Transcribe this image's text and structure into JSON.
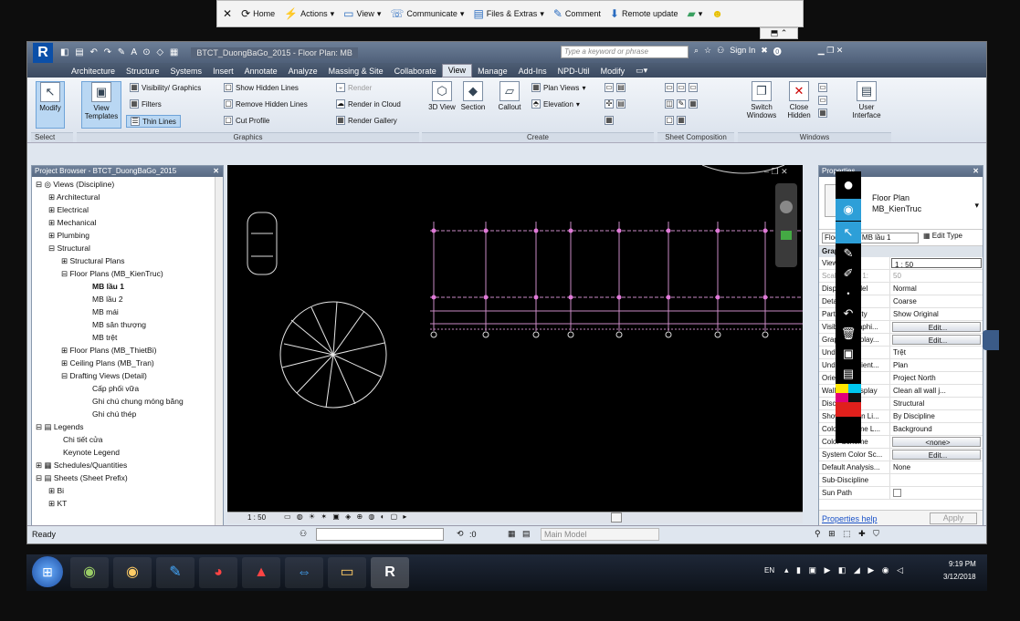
{
  "teamviewer": {
    "home": "Home",
    "actions": "Actions",
    "view": "View",
    "communicate": "Communicate",
    "files": "Files & Extras",
    "comment": "Comment",
    "remote_update": "Remote update"
  },
  "window": {
    "search_placeholder": "Type a keyword or phrase",
    "sign_in": "Sign In",
    "doc_title": "BTCT_DuongBaGo_2015 - Floor Plan: MB"
  },
  "tabs": [
    "Architecture",
    "Structure",
    "Systems",
    "Insert",
    "Annotate",
    "Analyze",
    "Massing & Site",
    "Collaborate",
    "View",
    "Manage",
    "Add-Ins",
    "NPD-Util",
    "Modify"
  ],
  "ribbon": {
    "modify": "Modify",
    "select": "Select",
    "view_templates": "View Templates",
    "graphics": {
      "visibility": "Visibility/ Graphics",
      "filters": "Filters",
      "thin_lines": "Thin Lines",
      "show_hidden": "Show Hidden Lines",
      "remove_hidden": "Remove Hidden Lines",
      "cut_profile": "Cut Profile",
      "render": "Render",
      "render_cloud": "Render in Cloud",
      "render_gallery": "Render Gallery",
      "label": "Graphics"
    },
    "create": {
      "view3d": "3D View",
      "section": "Section",
      "callout": "Callout",
      "plan_views": "Plan Views",
      "elevation": "Elevation",
      "label": "Create"
    },
    "sheet": {
      "label": "Sheet Composition"
    },
    "windows": {
      "switch": "Switch Windows",
      "close_hidden": "Close Hidden",
      "user_interface": "User Interface",
      "label": "Windows"
    }
  },
  "project_browser": {
    "title": "Project Browser - BTCT_DuongBaGo_2015",
    "items": [
      "Views (Discipline)",
      "Architectural",
      "Electrical",
      "Mechanical",
      "Plumbing",
      "Structural",
      "Structural Plans",
      "Floor Plans (MB_KienTruc)",
      "MB lầu 1",
      "MB lầu 2",
      "MB mái",
      "MB sân thượng",
      "MB trệt",
      "Floor Plans (MB_ThietBi)",
      "Ceiling Plans (MB_Tran)",
      "Drafting Views (Detail)",
      "Cấp phối vữa",
      "Ghi chú chung móng băng",
      "Ghi chú thép",
      "Legends",
      "Chi tiết cửa",
      "Keynote Legend",
      "Schedules/Quantities",
      "Sheets (Sheet Prefix)",
      "Bi",
      "KT"
    ]
  },
  "view_bar": {
    "scale": "1 : 50"
  },
  "properties": {
    "title": "Properties",
    "type": "Floor Plan",
    "type_sub": "MB_KienTruc",
    "selector": "Floor Plan: MB lầu 1",
    "edit_type": "Edit Type",
    "group": "Graphics",
    "rows": [
      {
        "k": "View Scale",
        "v": "1 : 50"
      },
      {
        "k": "Scale Value 1:",
        "v": "50"
      },
      {
        "k": "Display Model",
        "v": "Normal"
      },
      {
        "k": "Detail Level",
        "v": "Coarse"
      },
      {
        "k": "Parts Visibility",
        "v": "Show Original"
      },
      {
        "k": "Visibility/Graphi...",
        "v": "Edit..."
      },
      {
        "k": "Graphic Display...",
        "v": "Edit..."
      },
      {
        "k": "Underlay",
        "v": "Trệt"
      },
      {
        "k": "Underlay Orient...",
        "v": "Plan"
      },
      {
        "k": "Orientation",
        "v": "Project North"
      },
      {
        "k": "Wall Join Display",
        "v": "Clean all wall j..."
      },
      {
        "k": "Discipline",
        "v": "Structural"
      },
      {
        "k": "Show Hidden Li...",
        "v": "By Discipline"
      },
      {
        "k": "Color Scheme L...",
        "v": "Background"
      },
      {
        "k": "Color Scheme",
        "v": "<none>"
      },
      {
        "k": "System Color Sc...",
        "v": "Edit..."
      },
      {
        "k": "Default Analysis...",
        "v": "None"
      },
      {
        "k": "Sub-Discipline",
        "v": ""
      },
      {
        "k": "Sun Path",
        "v": ""
      }
    ],
    "help": "Properties help",
    "apply": "Apply"
  },
  "status": {
    "ready": "Ready",
    "model": "Main Model",
    "zero": ":0"
  },
  "taskbar": {
    "lang": "EN",
    "time": "9:19 PM",
    "date": "3/12/2018"
  }
}
